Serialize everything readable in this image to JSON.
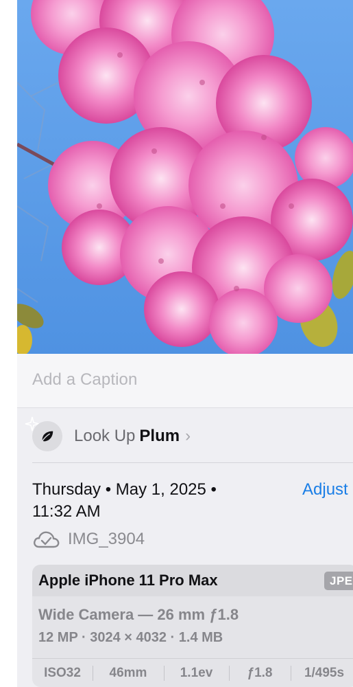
{
  "caption": {
    "placeholder": "Add a Caption"
  },
  "lookup": {
    "prefix": "Look Up",
    "subject": "Plum",
    "chevron": "›",
    "icon": "leaf-icon"
  },
  "metadata": {
    "date_time": "Thursday • May 1, 2025 • 11:32 AM",
    "adjust_label": "Adjust",
    "filename": "IMG_3904",
    "cloud_icon": "cloud-check-icon"
  },
  "camera": {
    "device": "Apple iPhone 11 Pro Max",
    "format": "JPEG",
    "lens": "Wide Camera — 26 mm ƒ1.8",
    "specs": "12 MP · 3024 × 4032 · 1.4 MB",
    "exif": [
      "ISO32",
      "46mm",
      "1.1ev",
      "ƒ1.8",
      "1/495s"
    ]
  },
  "colors": {
    "accent": "#1a7ee6",
    "sky": "#5f9ee8",
    "blossom": "#f07cc0",
    "panel": "#efeff3"
  }
}
